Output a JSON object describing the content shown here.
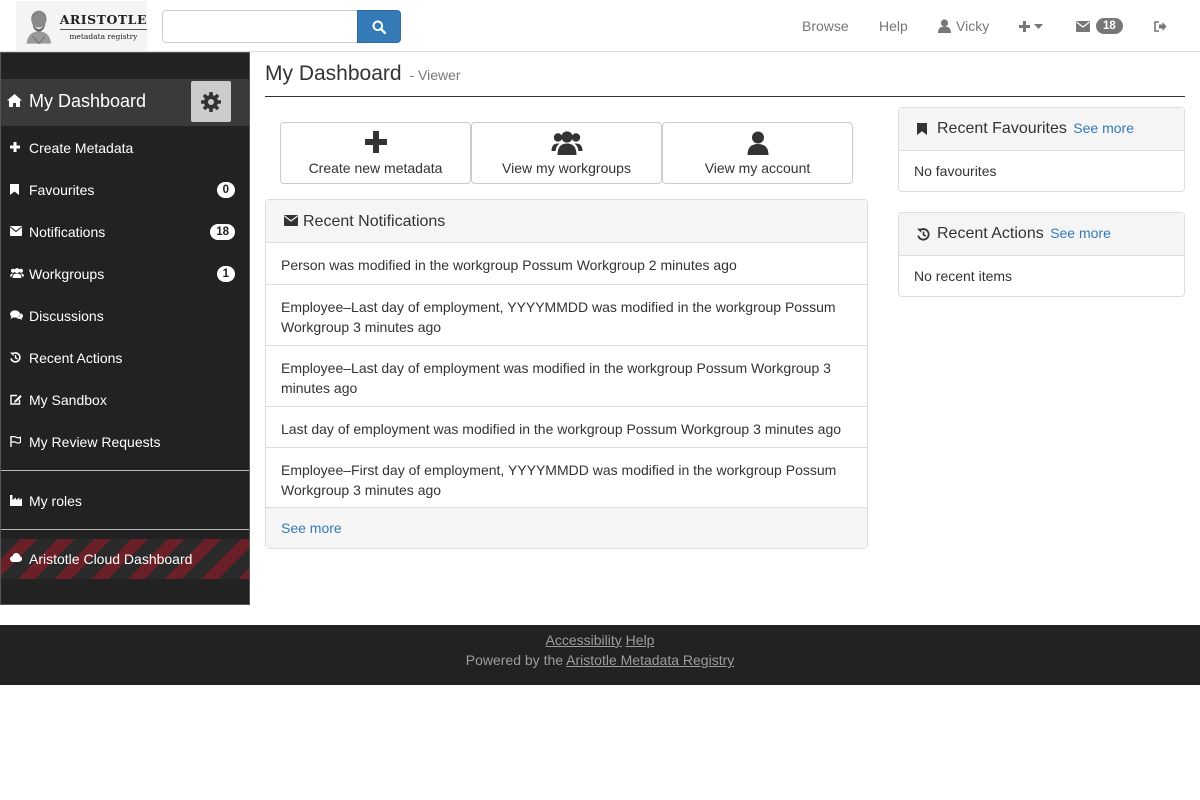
{
  "brand": {
    "name": "ARISTOTLE",
    "tagline": "metadata registry"
  },
  "search": {
    "value": "",
    "placeholder": ""
  },
  "nav": {
    "browse": "Browse",
    "help": "Help",
    "user": "Vicky",
    "mail_count": "18"
  },
  "sidebar": {
    "title": "My Dashboard",
    "items": [
      {
        "label": "Create Metadata",
        "icon": "plus-icon"
      },
      {
        "label": "Favourites",
        "icon": "bookmark-icon",
        "badge": "0"
      },
      {
        "label": "Notifications",
        "icon": "envelope-icon",
        "badge": "18"
      },
      {
        "label": "Workgroups",
        "icon": "users-icon",
        "badge": "1"
      },
      {
        "label": "Discussions",
        "icon": "comments-icon"
      },
      {
        "label": "Recent Actions",
        "icon": "history-icon"
      },
      {
        "label": "My Sandbox",
        "icon": "edit-icon"
      },
      {
        "label": "My Review Requests",
        "icon": "flag-icon"
      }
    ],
    "roles": {
      "label": "My roles",
      "icon": "industry-icon"
    },
    "cloud": {
      "label": "Aristotle Cloud Dashboard",
      "icon": "cloud-icon"
    }
  },
  "page": {
    "title": "My Dashboard",
    "subtitle": "- Viewer"
  },
  "quick_actions": [
    {
      "label": "Create new metadata",
      "icon": "plus-icon"
    },
    {
      "label": "View my workgroups",
      "icon": "users-icon"
    },
    {
      "label": "View my account",
      "icon": "user-icon"
    }
  ],
  "notifications": {
    "title": "Recent Notifications",
    "items": [
      "Person was modified in the workgroup Possum Workgroup 2 minutes ago",
      "Employee–Last day of employment, YYYYMMDD was modified in the workgroup Possum Workgroup 3 minutes ago",
      "Employee–Last day of employment was modified in the workgroup Possum Workgroup 3 minutes ago",
      "Last day of employment was modified in the workgroup Possum Workgroup 3 minutes ago",
      "Employee–First day of employment, YYYYMMDD was modified in the workgroup Possum Workgroup 3 minutes ago"
    ],
    "see_more": "See more"
  },
  "favourites": {
    "title": "Recent Favourites",
    "see_more": "See more",
    "empty": "No favourites"
  },
  "recent_actions": {
    "title": "Recent Actions",
    "see_more": "See more",
    "empty": "No recent items"
  },
  "footer": {
    "accessibility": "Accessibility",
    "help": "Help",
    "powered_by": "Powered by the",
    "registry_link": "Aristotle Metadata Registry"
  },
  "colors": {
    "primary": "#337ab7",
    "sidebar_bg": "#222222",
    "footer_bg": "#222222",
    "cloud_stripe": "#6b1f26"
  }
}
